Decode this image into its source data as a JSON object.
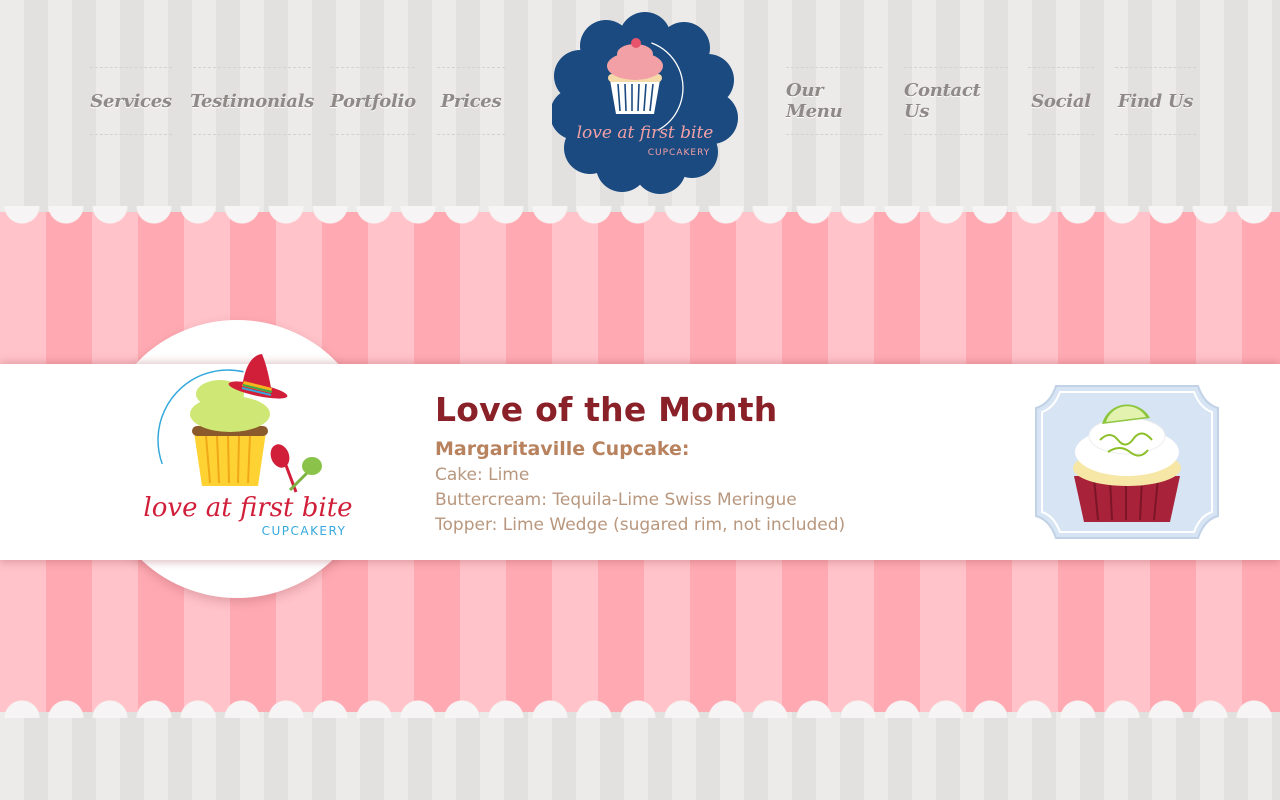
{
  "nav": {
    "left": [
      "Services",
      "Testimonials",
      "Portfolio",
      "Prices"
    ],
    "right": [
      "Our Menu",
      "Contact Us",
      "Social",
      "Find Us"
    ]
  },
  "logo": {
    "line1": "love at first bite",
    "line2": "CUPCAKERY"
  },
  "feature": {
    "title": "Love of the Month",
    "product_name": "Margaritaville Cupcake:",
    "details": [
      "Cake: Lime",
      "Buttercream: Tequila-Lime Swiss Meringue",
      "Topper: Lime Wedge (sugared rim, not included)"
    ],
    "badge_line1": "love at first bite",
    "badge_line2": "CUPCAKERY"
  },
  "icons": {
    "main_logo": "cupcake-logo-icon",
    "badge_logo": "sombrero-cupcake-logo-icon",
    "featured": "lime-cupcake-icon"
  },
  "colors": {
    "logo_blue": "#1a4a80",
    "title_red": "#8a2028",
    "product_brown": "#b8825e",
    "pink_light": "#ffc3c9",
    "pink_dark": "#ffaab3"
  }
}
